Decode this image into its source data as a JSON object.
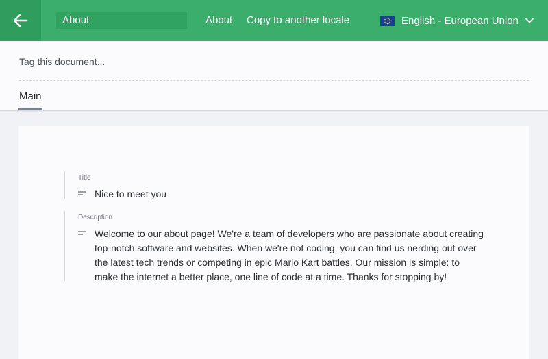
{
  "header": {
    "document_title": "About",
    "nav": [
      {
        "label": "About"
      },
      {
        "label": "Copy to another locale"
      }
    ],
    "locale": {
      "label": "English - European Union",
      "flag_icon": "eu-flag-icon"
    },
    "accent_color": "#3aae6a"
  },
  "subheader": {
    "tag_placeholder": "Tag this document...",
    "tabs": [
      {
        "label": "Main",
        "active": true
      }
    ]
  },
  "fields": {
    "title": {
      "label": "Title",
      "value": "Nice to meet you"
    },
    "description": {
      "label": "Description",
      "value": "Welcome to our about page! We're a team of developers who are passionate about creating top-notch software and websites. When we're not coding, you can find us nerding out over the latest tech trends or competing in epic Mario Kart battles. Our mission is simple: to make the internet a better place, one line of code at a time. Thanks for stopping by!"
    }
  }
}
